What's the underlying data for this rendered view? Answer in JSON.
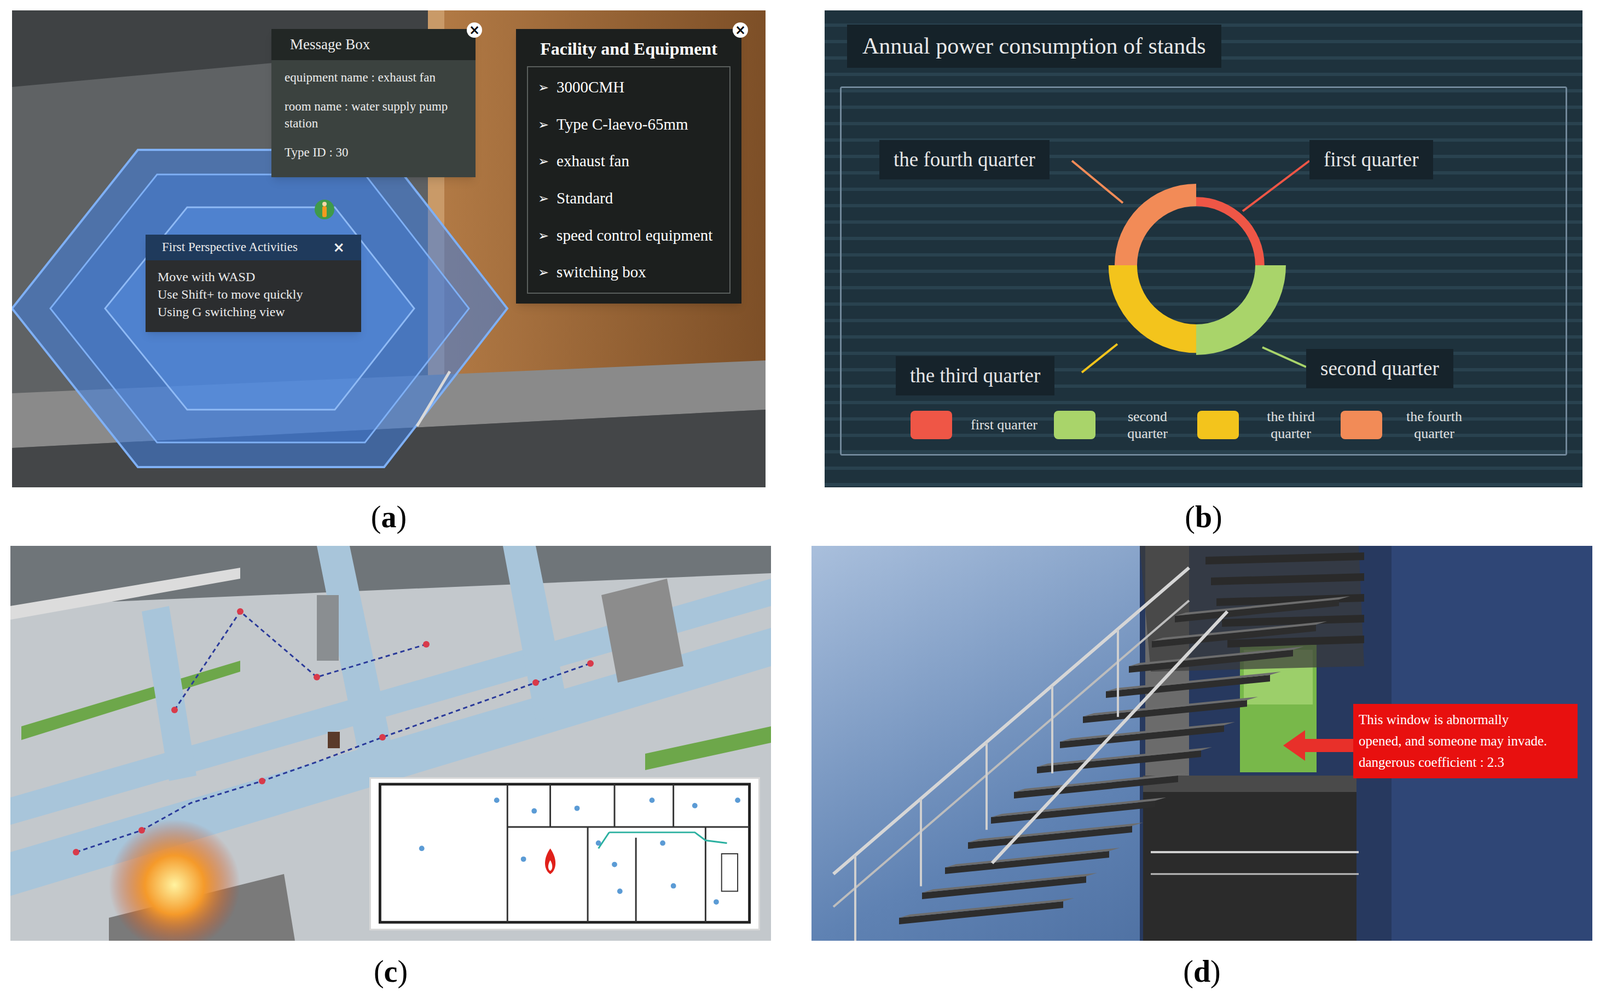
{
  "panels": {
    "a": {
      "caption": [
        "(",
        "a",
        ")"
      ],
      "message_box": {
        "title": "Message Box",
        "close": "×",
        "lines": [
          "equipment name : exhaust fan",
          "room name : water supply pump station",
          "Type ID : 30"
        ]
      },
      "facility": {
        "title": "Facility and Equipment",
        "close": "×",
        "bullet": "➢",
        "items": [
          "3000CMH",
          "Type C-laevo-65mm",
          "exhaust fan",
          "Standard",
          "speed control equipment",
          "switching box"
        ]
      },
      "perspective": {
        "title": "First Perspective Activities",
        "close": "×",
        "lines": [
          "Move with WASD",
          "Use Shift+ to move quickly",
          "Using G switching view"
        ]
      }
    },
    "b": {
      "caption": [
        "(",
        "b",
        ")"
      ],
      "chart": {
        "title": "Annual power consumption of stands",
        "segments": [
          {
            "label": "first quarter",
            "value": 9,
            "color": "#ef5646"
          },
          {
            "label": "second quarter",
            "value": 30,
            "color": "#a9d46a"
          },
          {
            "label": "the third quarter",
            "value": 28,
            "color": "#f3c41c"
          },
          {
            "label": "the fourth quarter",
            "value": 22,
            "color": "#f28b57"
          }
        ]
      }
    },
    "c": {
      "caption": [
        "(",
        "c",
        ")"
      ]
    },
    "d": {
      "caption": [
        "(",
        "d",
        ")"
      ],
      "alert": {
        "lines": [
          "This window is abnormally",
          "opened, and someone may invade.",
          "dangerous coefficient : 2.3"
        ]
      }
    }
  }
}
